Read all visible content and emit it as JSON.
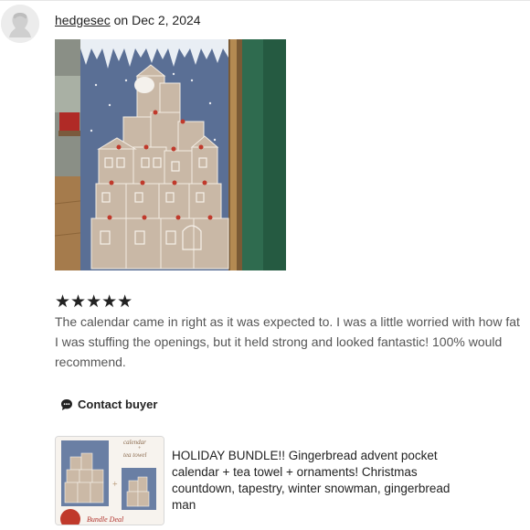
{
  "review": {
    "username": "hedgesec",
    "date_prefix": "on",
    "date": "Dec 2, 2024",
    "stars": "★★★★★",
    "rating": 5,
    "text": "The calendar came in right as it was expected to. I was a little worried with how fat I was stuffing the openings, but it held strong and looked fantastic! 100% would recommend."
  },
  "actions": {
    "contact_label": "Contact buyer"
  },
  "product": {
    "title": "HOLIDAY BUNDLE!! Gingerbread advent pocket calendar + tea towel + ornaments! Christmas countdown, tapestry, winter snowman, gingerbread man",
    "thumb_text_1": "calendar",
    "thumb_text_2": "+",
    "thumb_text_3": "tea towel",
    "thumb_badge": "Bundle Deal"
  },
  "icons": {
    "avatar": "user-silhouette-icon",
    "contact": "chat-bubble-icon"
  },
  "colors": {
    "text": "#222222",
    "muted_text": "#555555",
    "calendar_blue": "#5a6f95",
    "gingerbread": "#c9b8a6",
    "door_green": "#2f6b4f"
  }
}
